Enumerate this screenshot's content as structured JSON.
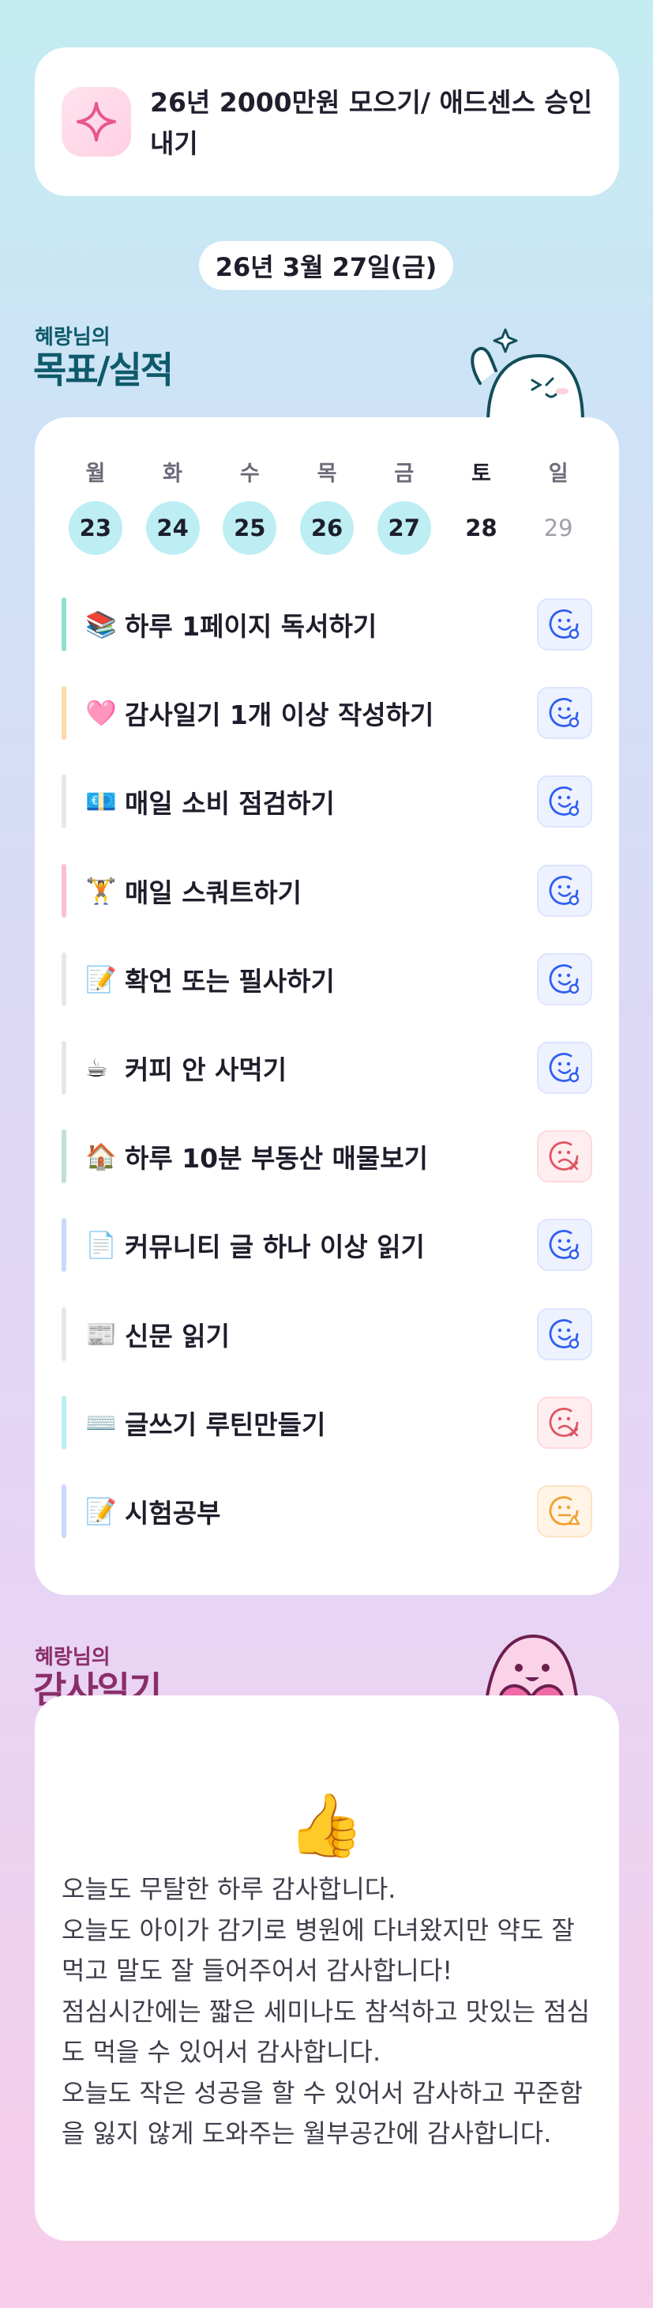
{
  "goal": {
    "text": "26년 2000만원 모으기/ 애드센스 승인내기",
    "icon": "sparkle-icon"
  },
  "date": "26년 3월 27일(금)",
  "goals_section": {
    "subtitle": "혜랑님의",
    "title": "목표/실적"
  },
  "week": [
    {
      "day": "월",
      "date": "23",
      "state": "done"
    },
    {
      "day": "화",
      "date": "24",
      "state": "done"
    },
    {
      "day": "수",
      "date": "25",
      "state": "done"
    },
    {
      "day": "목",
      "date": "26",
      "state": "done"
    },
    {
      "day": "금",
      "date": "27",
      "state": "done"
    },
    {
      "day": "토",
      "date": "28",
      "state": "today"
    },
    {
      "day": "일",
      "date": "29",
      "state": "future"
    }
  ],
  "habits": [
    {
      "emoji": "📚",
      "label": "하루 1페이지 독서하기",
      "status": "ok",
      "bar_color": "#8fe0cf"
    },
    {
      "emoji": "🩷",
      "label": "감사일기 1개 이상 작성하기",
      "status": "ok",
      "bar_color": "#fbdca4"
    },
    {
      "emoji": "💶",
      "label": "매일 소비 점검하기",
      "status": "ok",
      "bar_color": "#e6e6ef"
    },
    {
      "emoji": "🏋️",
      "label": "매일 스쿼트하기",
      "status": "ok",
      "bar_color": "#f9bfd7"
    },
    {
      "emoji": "📝",
      "label": "확언 또는 필사하기",
      "status": "ok",
      "bar_color": "#e6e6ef"
    },
    {
      "emoji": "☕",
      "label": "커피 안 사먹기",
      "status": "ok",
      "bar_color": "#e6e6ef"
    },
    {
      "emoji": "🏠",
      "label": "하루 10분 부동산 매물보기",
      "status": "fail",
      "bar_color": "#bfe0d6"
    },
    {
      "emoji": "📄",
      "label": "커뮤니티 글 하나 이상 읽기",
      "status": "ok",
      "bar_color": "#cbd8fb"
    },
    {
      "emoji": "📰",
      "label": "신문 읽기",
      "status": "ok",
      "bar_color": "#e6e6ef"
    },
    {
      "emoji": "⌨️",
      "label": "글쓰기 루틴만들기",
      "status": "fail",
      "bar_color": "#bdeef3"
    },
    {
      "emoji": "📝",
      "label": "시험공부",
      "status": "partial",
      "bar_color": "#cbd8fb"
    }
  ],
  "diary_section": {
    "subtitle": "혜랑님의",
    "title": "감사일기"
  },
  "diary": {
    "emoji": "👍",
    "lines": [
      "오늘도 무탈한 하루 감사합니다.",
      "오늘도 아이가 감기로 병원에 다녀왔지만 약도 잘 먹고 말도 잘 들어주어서 감사합니다!",
      "점심시간에는 짧은 세미나도 참석하고 맛있는 점심도 먹을 수 있어서 감사합니다.",
      "오늘도 작은 성공을 할 수 있어서 감사하고 꾸준함을 잃지 않게 도와주는 월부공간에 감사합니다."
    ]
  },
  "colors": {
    "accent_teal": "#0e5a6b",
    "accent_plum": "#8a2e6a",
    "ok": "#2f5ff0",
    "fail": "#e05563",
    "partial": "#f0a030"
  }
}
